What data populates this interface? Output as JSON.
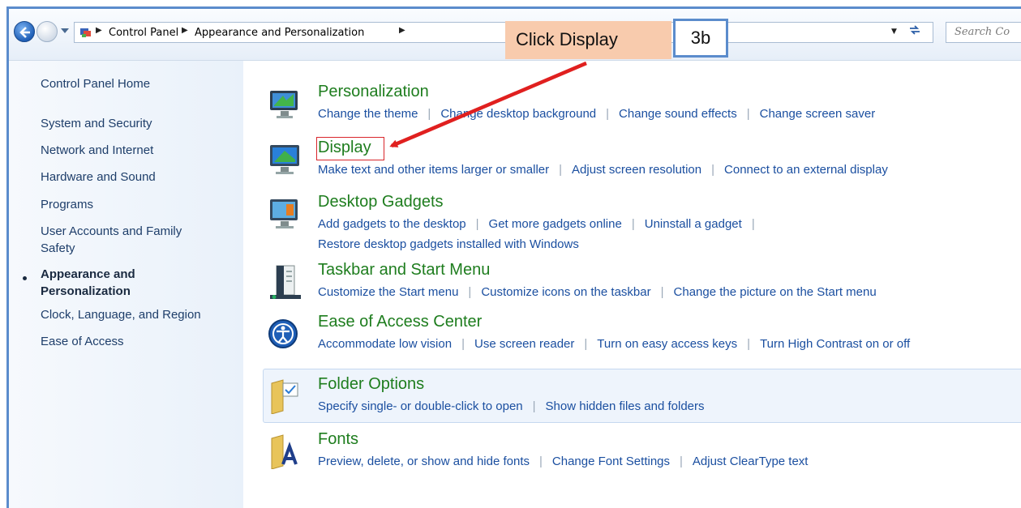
{
  "address": {
    "crumbs": [
      "Control Panel",
      "Appearance and Personalization"
    ],
    "search_placeholder": "Search Co"
  },
  "callout": {
    "text": "Click Display",
    "step": "3b"
  },
  "sidebar": {
    "items": [
      {
        "label": "Control Panel Home"
      },
      {
        "label": "System and Security"
      },
      {
        "label": "Network and Internet"
      },
      {
        "label": "Hardware and Sound"
      },
      {
        "label": "Programs"
      },
      {
        "label": "User Accounts and Family Safety"
      },
      {
        "label": "Appearance and Personalization"
      },
      {
        "label": "Clock, Language, and Region"
      },
      {
        "label": "Ease of Access"
      }
    ]
  },
  "tasks": [
    {
      "title": "Personalization",
      "icon": "personalization-icon",
      "links": [
        "Change the theme",
        "Change desktop background",
        "Change sound effects",
        "Change screen saver"
      ]
    },
    {
      "title": "Display",
      "icon": "display-icon",
      "links": [
        "Make text and other items larger or smaller",
        "Adjust screen resolution",
        "Connect to an external display"
      ]
    },
    {
      "title": "Desktop Gadgets",
      "icon": "gadgets-icon",
      "links": [
        "Add gadgets to the desktop",
        "Get more gadgets online",
        "Uninstall a gadget",
        "Restore desktop gadgets installed with Windows"
      ]
    },
    {
      "title": "Taskbar and Start Menu",
      "icon": "taskbar-icon",
      "links": [
        "Customize the Start menu",
        "Customize icons on the taskbar",
        "Change the picture on the Start menu"
      ]
    },
    {
      "title": "Ease of Access Center",
      "icon": "ease-of-access-icon",
      "links": [
        "Accommodate low vision",
        "Use screen reader",
        "Turn on easy access keys",
        "Turn High Contrast on or off"
      ]
    },
    {
      "title": "Folder Options",
      "icon": "folder-options-icon",
      "links": [
        "Specify single- or double-click to open",
        "Show hidden files and folders"
      ]
    },
    {
      "title": "Fonts",
      "icon": "fonts-icon",
      "links": [
        "Preview, delete, or show and hide fonts",
        "Change Font Settings",
        "Adjust ClearType text"
      ]
    }
  ],
  "colors": {
    "title_green": "#1e7d1e",
    "link_blue": "#1b4fa0",
    "callout_fill": "#f8cbad",
    "highlight_red": "#d9262b"
  }
}
